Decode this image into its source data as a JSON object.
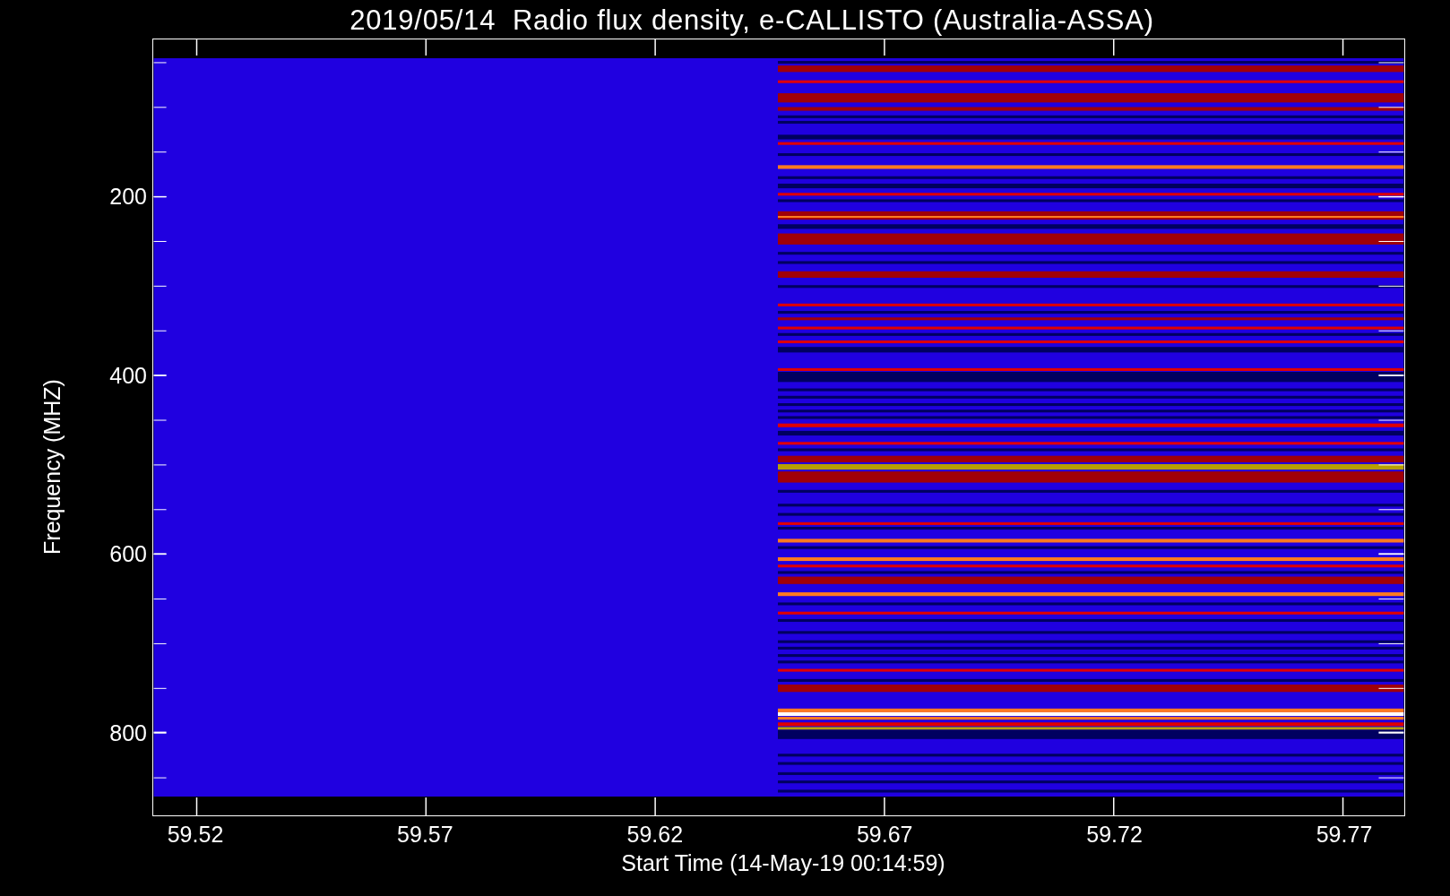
{
  "title": "2019/05/14  Radio flux density, e-CALLISTO (Australia-ASSA)",
  "x_axis": {
    "label": "Start Time (14-May-19 00:14:59)",
    "ticks": [
      "59.52",
      "59.57",
      "59.62",
      "59.67",
      "59.72",
      "59.77"
    ]
  },
  "y_axis": {
    "label": "Frequency (MHZ)",
    "ticks": [
      "200",
      "400",
      "600",
      "800"
    ]
  }
}
